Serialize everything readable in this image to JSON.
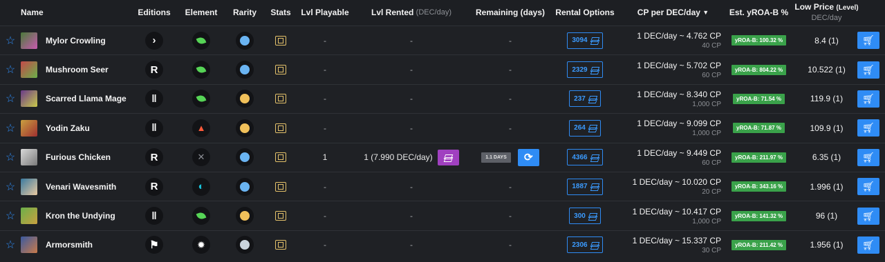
{
  "headers": {
    "name": "Name",
    "editions": "Editions",
    "element": "Element",
    "rarity": "Rarity",
    "stats": "Stats",
    "lvl_playable": "Lvl Playable",
    "lvl_rented": "Lvl Rented",
    "lvl_rented_unit": "(DEC/day)",
    "remaining": "Remaining (days)",
    "rental_options": "Rental Options",
    "cp_per_dec": "CP per DEC/day",
    "yroa": "Est. yROA-B %",
    "low_price": "Low Price",
    "low_price_level": "(Level)",
    "low_price_unit": "DEC/day"
  },
  "rows": [
    {
      "name": "Mylor Crowling",
      "edition_icon": "chevron-icon",
      "element_icon": "leaf-icon",
      "rarity_color": "#6ab4f2",
      "lvl_playable": "-",
      "lvl_rented": "-",
      "remaining": "-",
      "rental_count": "3094",
      "cp_main": "1 DEC/day ~ 4.762 CP",
      "cp_sub": "40 CP",
      "yroa": "yROA-B: 100.32 %",
      "low_price": "8.4 (1)"
    },
    {
      "name": "Mushroom Seer",
      "edition_icon": "r-icon",
      "element_icon": "leaf-icon",
      "rarity_color": "#6ab4f2",
      "lvl_playable": "-",
      "lvl_rented": "-",
      "remaining": "-",
      "rental_count": "2329",
      "cp_main": "1 DEC/day ~ 5.702 CP",
      "cp_sub": "60 CP",
      "yroa": "yROA-B: 804.22 %",
      "low_price": "10.522 (1)"
    },
    {
      "name": "Scarred Llama Mage",
      "edition_icon": "pillar-icon",
      "element_icon": "leaf-icon",
      "rarity_color": "#f0c05a",
      "lvl_playable": "-",
      "lvl_rented": "-",
      "remaining": "-",
      "rental_count": "237",
      "cp_main": "1 DEC/day ~ 8.340 CP",
      "cp_sub": "1,000 CP",
      "yroa": "yROA-B: 71.54 %",
      "low_price": "119.9 (1)"
    },
    {
      "name": "Yodin Zaku",
      "edition_icon": "pillar-icon",
      "element_icon": "fire-icon",
      "rarity_color": "#f0c05a",
      "lvl_playable": "-",
      "lvl_rented": "-",
      "remaining": "-",
      "rental_count": "264",
      "cp_main": "1 DEC/day ~ 9.099 CP",
      "cp_sub": "1,000 CP",
      "yroa": "yROA-B: 71.87 %",
      "low_price": "109.9 (1)"
    },
    {
      "name": "Furious Chicken",
      "edition_icon": "r-icon",
      "element_icon": "neutral-icon",
      "rarity_color": "#6ab4f2",
      "lvl_playable": "1",
      "lvl_rented": "1 (7.990 DEC/day)",
      "remaining": "1.1 DAYS",
      "rental_count": "4366",
      "cp_main": "1 DEC/day ~ 9.449 CP",
      "cp_sub": "60 CP",
      "yroa": "yROA-B: 211.97 %",
      "low_price": "6.35 (1)"
    },
    {
      "name": "Venari Wavesmith",
      "edition_icon": "r-icon",
      "element_icon": "water-icon",
      "rarity_color": "#6ab4f2",
      "lvl_playable": "-",
      "lvl_rented": "-",
      "remaining": "-",
      "rental_count": "1887",
      "cp_main": "1 DEC/day ~ 10.020 CP",
      "cp_sub": "20 CP",
      "yroa": "yROA-B: 343.16 %",
      "low_price": "1.996 (1)"
    },
    {
      "name": "Kron the Undying",
      "edition_icon": "pillar-icon",
      "element_icon": "leaf-icon",
      "rarity_color": "#f0c05a",
      "lvl_playable": "-",
      "lvl_rented": "-",
      "remaining": "-",
      "rental_count": "300",
      "cp_main": "1 DEC/day ~ 10.417 CP",
      "cp_sub": "1,000 CP",
      "yroa": "yROA-B: 141.32 %",
      "low_price": "96 (1)"
    },
    {
      "name": "Armorsmith",
      "edition_icon": "flag-icon",
      "element_icon": "sun-icon",
      "rarity_color": "#c9d3dc",
      "lvl_playable": "-",
      "lvl_rented": "-",
      "remaining": "-",
      "rental_count": "2306",
      "cp_main": "1 DEC/day ~ 15.337 CP",
      "cp_sub": "30 CP",
      "yroa": "yROA-B: 211.42 %",
      "low_price": "1.956 (1)"
    }
  ]
}
